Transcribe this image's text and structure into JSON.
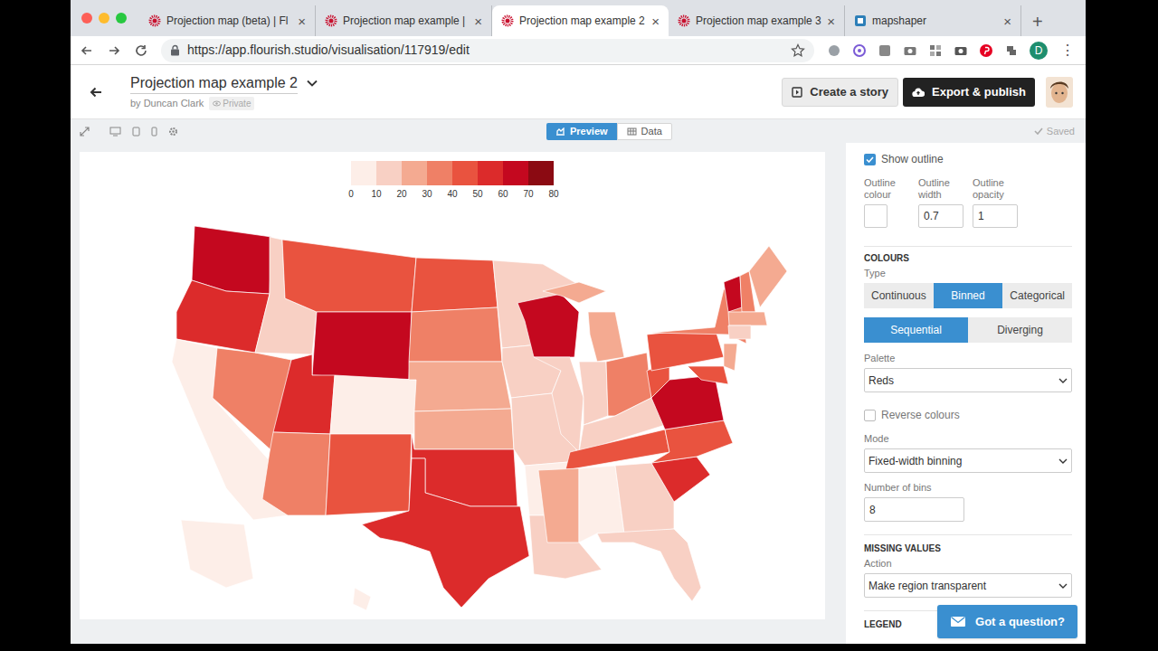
{
  "browser": {
    "tabs": [
      {
        "label": "Projection map (beta) | Fl",
        "selected": false
      },
      {
        "label": "Projection map example |",
        "selected": false
      },
      {
        "label": "Projection map example 2",
        "selected": true
      },
      {
        "label": "Projection map example 3",
        "selected": false
      },
      {
        "label": "mapshaper",
        "selected": false
      }
    ],
    "close": "×",
    "new_tab": "+",
    "url": "https://app.flourish.studio/visualisation/117919/edit",
    "profile": "D",
    "menu": "⋮"
  },
  "header": {
    "title": "Projection map example 2",
    "author": "by Duncan Clark",
    "privacy": "Private",
    "create_story": "Create a story",
    "export": "Export & publish"
  },
  "toolbar": {
    "views": [
      {
        "label": "Preview",
        "selected": true
      },
      {
        "label": "Data",
        "selected": false
      }
    ],
    "saved": "Saved"
  },
  "map": {
    "legend": {
      "bins": [
        {
          "color": "#fdeee8"
        },
        {
          "color": "#f8d0c4"
        },
        {
          "color": "#f4aa91"
        },
        {
          "color": "#ef8066"
        },
        {
          "color": "#e9533f"
        },
        {
          "color": "#dc2b2b"
        },
        {
          "color": "#c4081f"
        },
        {
          "color": "#8b0a12"
        }
      ],
      "ticks": [
        "0",
        "10",
        "20",
        "30",
        "40",
        "50",
        "60",
        "70",
        "80"
      ]
    },
    "regions": [
      {
        "id": "WA",
        "value": 65
      },
      {
        "id": "OR",
        "value": 50
      },
      {
        "id": "CA",
        "value": 5
      },
      {
        "id": "NV",
        "value": 35
      },
      {
        "id": "ID",
        "value": 12
      },
      {
        "id": "MT",
        "value": 40
      },
      {
        "id": "WY",
        "value": 62
      },
      {
        "id": "UT",
        "value": 55
      },
      {
        "id": "AZ",
        "value": 35
      },
      {
        "id": "CO",
        "value": 5
      },
      {
        "id": "NM",
        "value": 40
      },
      {
        "id": "ND",
        "value": 40
      },
      {
        "id": "SD",
        "value": 32
      },
      {
        "id": "NE",
        "value": 25
      },
      {
        "id": "KS",
        "value": 20
      },
      {
        "id": "OK",
        "value": 52
      },
      {
        "id": "TX",
        "value": 55
      },
      {
        "id": "MN",
        "value": 18
      },
      {
        "id": "IA",
        "value": 12
      },
      {
        "id": "MO",
        "value": 15
      },
      {
        "id": "AR",
        "value": 5
      },
      {
        "id": "LA",
        "value": 15
      },
      {
        "id": "WI",
        "value": 68
      },
      {
        "id": "IL",
        "value": 10
      },
      {
        "id": "MI",
        "value": 20
      },
      {
        "id": "MIU",
        "value": 20
      },
      {
        "id": "IN",
        "value": 10
      },
      {
        "id": "OH",
        "value": 35
      },
      {
        "id": "KY",
        "value": 15
      },
      {
        "id": "TN",
        "value": 45
      },
      {
        "id": "MS",
        "value": 20
      },
      {
        "id": "AL",
        "value": 5
      },
      {
        "id": "GA",
        "value": 15
      },
      {
        "id": "FL",
        "value": 10
      },
      {
        "id": "SC",
        "value": 58
      },
      {
        "id": "NC",
        "value": 45
      },
      {
        "id": "VA",
        "value": 68
      },
      {
        "id": "WV",
        "value": 40
      },
      {
        "id": "PA",
        "value": 40
      },
      {
        "id": "NY",
        "value": 35
      },
      {
        "id": "VT",
        "value": 68
      },
      {
        "id": "NH",
        "value": 30
      },
      {
        "id": "ME",
        "value": 20
      },
      {
        "id": "MA",
        "value": 20
      },
      {
        "id": "CT",
        "value": 10
      },
      {
        "id": "NJ",
        "value": 25
      },
      {
        "id": "MD",
        "value": 40
      },
      {
        "id": "AK",
        "value": 2
      },
      {
        "id": "HI",
        "value": 5
      }
    ]
  },
  "settings": {
    "show_outline": {
      "label": "Show outline",
      "checked": true
    },
    "outline_fields": [
      {
        "label": "Outline colour",
        "kind": "swatch",
        "color": "#ffffff"
      },
      {
        "label": "Outline width",
        "kind": "input",
        "value": "0.7"
      },
      {
        "label": "Outline opacity",
        "kind": "input",
        "value": "1"
      }
    ],
    "colours": {
      "heading": "COLOURS",
      "type_label": "Type",
      "types": [
        {
          "label": "Continuous",
          "selected": false
        },
        {
          "label": "Binned",
          "selected": true
        },
        {
          "label": "Categorical",
          "selected": false
        }
      ],
      "scales": [
        {
          "label": "Sequential",
          "selected": true
        },
        {
          "label": "Diverging",
          "selected": false
        }
      ],
      "palette_label": "Palette",
      "palette": "Reds",
      "reverse": {
        "label": "Reverse colours",
        "checked": false
      },
      "mode_label": "Mode",
      "mode": "Fixed-width binning",
      "bins_label": "Number of bins",
      "bins": "8"
    },
    "missing": {
      "heading": "MISSING VALUES",
      "action_label": "Action",
      "action": "Make region transparent"
    },
    "legend_heading": "LEGEND"
  },
  "help": "Got a question?"
}
